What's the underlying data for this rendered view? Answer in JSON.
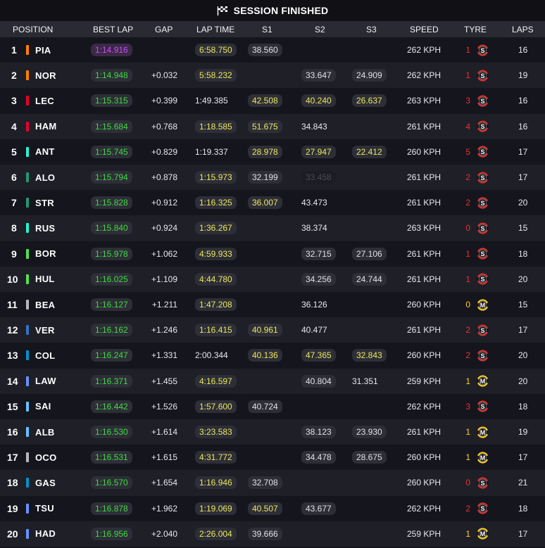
{
  "session": {
    "title": "SESSION FINISHED",
    "icon": "checkered-flag-icon"
  },
  "columns": {
    "position": "POSITION",
    "best_lap": "BEST LAP",
    "gap": "GAP",
    "lap_time": "LAP TIME",
    "s1": "S1",
    "s2": "S2",
    "s3": "S3",
    "speed": "SPEED",
    "tyre": "TYRE",
    "laps": "LAPS"
  },
  "colors": {
    "best_lap_overall": "#c94cff",
    "personal_best": "#3ddc3d",
    "yellow_time": "#e8e85a",
    "soft_tyre": "#e2342c",
    "medium_tyre": "#ffd21e",
    "mclaren": "#ff8000",
    "ferrari": "#e8002d",
    "mercedes": "#27f4d2",
    "aston_martin": "#229971",
    "sauber": "#52e252",
    "haas": "#b6babd",
    "red_bull": "#3671c6",
    "alpine": "#0093cc",
    "williams": "#64c4ff",
    "racing_bulls": "#6692ff"
  },
  "rows": [
    {
      "pos": "1",
      "driver": "PIA",
      "team_color": "#ff8000",
      "best_lap": "1:14.916",
      "best_lap_style": "purple",
      "gap": "",
      "lap_time": "6:58.750",
      "lap_time_style": "yellow",
      "s1": "38.560",
      "s1_style": "grey",
      "s2": "",
      "s2_style": "",
      "s3": "",
      "s3_style": "",
      "speed": "262 KPH",
      "tyre_age": "1",
      "tyre": "S",
      "laps": "16"
    },
    {
      "pos": "2",
      "driver": "NOR",
      "team_color": "#ff8000",
      "best_lap": "1:14.948",
      "best_lap_style": "green",
      "gap": "+0.032",
      "lap_time": "5:58.232",
      "lap_time_style": "yellow",
      "s1": "",
      "s1_style": "",
      "s2": "33.647",
      "s2_style": "grey",
      "s3": "24.909",
      "s3_style": "grey",
      "speed": "262 KPH",
      "tyre_age": "1",
      "tyre": "S",
      "laps": "19"
    },
    {
      "pos": "3",
      "driver": "LEC",
      "team_color": "#e8002d",
      "best_lap": "1:15.315",
      "best_lap_style": "green",
      "gap": "+0.399",
      "lap_time": "1:49.385",
      "lap_time_style": "plain",
      "s1": "42.508",
      "s1_style": "yellow",
      "s2": "40.240",
      "s2_style": "yellow",
      "s3": "26.637",
      "s3_style": "yellow",
      "speed": "263 KPH",
      "tyre_age": "3",
      "tyre": "S",
      "laps": "16"
    },
    {
      "pos": "4",
      "driver": "HAM",
      "team_color": "#e8002d",
      "best_lap": "1:15.684",
      "best_lap_style": "green",
      "gap": "+0.768",
      "lap_time": "1:18.585",
      "lap_time_style": "yellow",
      "s1": "51.675",
      "s1_style": "yellow",
      "s2": "34.843",
      "s2_style": "plain",
      "s3": "",
      "s3_style": "",
      "speed": "261 KPH",
      "tyre_age": "4",
      "tyre": "S",
      "laps": "16"
    },
    {
      "pos": "5",
      "driver": "ANT",
      "team_color": "#27f4d2",
      "best_lap": "1:15.745",
      "best_lap_style": "green",
      "gap": "+0.829",
      "lap_time": "1:19.337",
      "lap_time_style": "plain",
      "s1": "28.978",
      "s1_style": "yellow",
      "s2": "27.947",
      "s2_style": "yellow",
      "s3": "22.412",
      "s3_style": "yellow",
      "speed": "260 KPH",
      "tyre_age": "5",
      "tyre": "S",
      "laps": "17"
    },
    {
      "pos": "6",
      "driver": "ALO",
      "team_color": "#229971",
      "best_lap": "1:15.794",
      "best_lap_style": "green",
      "gap": "+0.878",
      "lap_time": "1:15.973",
      "lap_time_style": "yellow",
      "s1": "32.199",
      "s1_style": "grey",
      "s2": "33.458",
      "s2_style": "faint",
      "s3": "",
      "s3_style": "",
      "speed": "261 KPH",
      "tyre_age": "2",
      "tyre": "S",
      "laps": "17"
    },
    {
      "pos": "7",
      "driver": "STR",
      "team_color": "#229971",
      "best_lap": "1:15.828",
      "best_lap_style": "green",
      "gap": "+0.912",
      "lap_time": "1:16.325",
      "lap_time_style": "yellow",
      "s1": "36.007",
      "s1_style": "yellow",
      "s2": "43.473",
      "s2_style": "plain",
      "s3": "",
      "s3_style": "",
      "speed": "261 KPH",
      "tyre_age": "2",
      "tyre": "S",
      "laps": "20"
    },
    {
      "pos": "8",
      "driver": "RUS",
      "team_color": "#27f4d2",
      "best_lap": "1:15.840",
      "best_lap_style": "green",
      "gap": "+0.924",
      "lap_time": "1:36.267",
      "lap_time_style": "yellow",
      "s1": "",
      "s1_style": "",
      "s2": "38.374",
      "s2_style": "plain",
      "s3": "",
      "s3_style": "",
      "speed": "263 KPH",
      "tyre_age": "0",
      "tyre": "S",
      "laps": "15"
    },
    {
      "pos": "9",
      "driver": "BOR",
      "team_color": "#52e252",
      "best_lap": "1:15.978",
      "best_lap_style": "green",
      "gap": "+1.062",
      "lap_time": "4:59.933",
      "lap_time_style": "yellow",
      "s1": "",
      "s1_style": "",
      "s2": "32.715",
      "s2_style": "grey",
      "s3": "27.106",
      "s3_style": "grey",
      "speed": "261 KPH",
      "tyre_age": "1",
      "tyre": "S",
      "laps": "18"
    },
    {
      "pos": "10",
      "driver": "HUL",
      "team_color": "#52e252",
      "best_lap": "1:16.025",
      "best_lap_style": "green",
      "gap": "+1.109",
      "lap_time": "4:44.780",
      "lap_time_style": "yellow",
      "s1": "",
      "s1_style": "",
      "s2": "34.256",
      "s2_style": "grey",
      "s3": "24.744",
      "s3_style": "grey",
      "speed": "261 KPH",
      "tyre_age": "1",
      "tyre": "S",
      "laps": "20"
    },
    {
      "pos": "11",
      "driver": "BEA",
      "team_color": "#b6babd",
      "best_lap": "1:16.127",
      "best_lap_style": "green",
      "gap": "+1.211",
      "lap_time": "1:47.208",
      "lap_time_style": "yellow",
      "s1": "",
      "s1_style": "",
      "s2": "36.126",
      "s2_style": "plain",
      "s3": "",
      "s3_style": "",
      "speed": "260 KPH",
      "tyre_age": "0",
      "tyre": "M",
      "laps": "15"
    },
    {
      "pos": "12",
      "driver": "VER",
      "team_color": "#3671c6",
      "best_lap": "1:16.162",
      "best_lap_style": "green",
      "gap": "+1.246",
      "lap_time": "1:16.415",
      "lap_time_style": "yellow",
      "s1": "40.961",
      "s1_style": "yellow",
      "s2": "40.477",
      "s2_style": "plain",
      "s3": "",
      "s3_style": "",
      "speed": "261 KPH",
      "tyre_age": "2",
      "tyre": "S",
      "laps": "17"
    },
    {
      "pos": "13",
      "driver": "COL",
      "team_color": "#0093cc",
      "best_lap": "1:16.247",
      "best_lap_style": "green",
      "gap": "+1.331",
      "lap_time": "2:00.344",
      "lap_time_style": "plain",
      "s1": "40.136",
      "s1_style": "yellow",
      "s2": "47.365",
      "s2_style": "yellow",
      "s3": "32.843",
      "s3_style": "yellow",
      "speed": "260 KPH",
      "tyre_age": "2",
      "tyre": "S",
      "laps": "20"
    },
    {
      "pos": "14",
      "driver": "LAW",
      "team_color": "#6692ff",
      "best_lap": "1:16.371",
      "best_lap_style": "green",
      "gap": "+1.455",
      "lap_time": "4:16.597",
      "lap_time_style": "yellow",
      "s1": "",
      "s1_style": "",
      "s2": "40.804",
      "s2_style": "grey",
      "s3": "31.351",
      "s3_style": "plain",
      "speed": "259 KPH",
      "tyre_age": "1",
      "tyre": "M",
      "laps": "20"
    },
    {
      "pos": "15",
      "driver": "SAI",
      "team_color": "#64c4ff",
      "best_lap": "1:16.442",
      "best_lap_style": "green",
      "gap": "+1.526",
      "lap_time": "1:57.600",
      "lap_time_style": "yellow",
      "s1": "40.724",
      "s1_style": "grey",
      "s2": "",
      "s2_style": "",
      "s3": "",
      "s3_style": "",
      "speed": "262 KPH",
      "tyre_age": "3",
      "tyre": "S",
      "laps": "18"
    },
    {
      "pos": "16",
      "driver": "ALB",
      "team_color": "#64c4ff",
      "best_lap": "1:16.530",
      "best_lap_style": "green",
      "gap": "+1.614",
      "lap_time": "3:23.583",
      "lap_time_style": "yellow",
      "s1": "",
      "s1_style": "",
      "s2": "38.123",
      "s2_style": "grey",
      "s3": "23.930",
      "s3_style": "grey",
      "speed": "261 KPH",
      "tyre_age": "1",
      "tyre": "M",
      "laps": "19"
    },
    {
      "pos": "17",
      "driver": "OCO",
      "team_color": "#b6babd",
      "best_lap": "1:16.531",
      "best_lap_style": "green",
      "gap": "+1.615",
      "lap_time": "4:31.772",
      "lap_time_style": "yellow",
      "s1": "",
      "s1_style": "",
      "s2": "34.478",
      "s2_style": "grey",
      "s3": "28.675",
      "s3_style": "grey",
      "speed": "260 KPH",
      "tyre_age": "1",
      "tyre": "M",
      "laps": "17"
    },
    {
      "pos": "18",
      "driver": "GAS",
      "team_color": "#0093cc",
      "best_lap": "1:16.570",
      "best_lap_style": "green",
      "gap": "+1.654",
      "lap_time": "1:16.946",
      "lap_time_style": "yellow",
      "s1": "32.708",
      "s1_style": "grey",
      "s2": "",
      "s2_style": "",
      "s3": "",
      "s3_style": "",
      "speed": "260 KPH",
      "tyre_age": "0",
      "tyre": "S",
      "laps": "21"
    },
    {
      "pos": "19",
      "driver": "TSU",
      "team_color": "#6692ff",
      "best_lap": "1:16.878",
      "best_lap_style": "green",
      "gap": "+1.962",
      "lap_time": "1:19.069",
      "lap_time_style": "yellow",
      "s1": "40.507",
      "s1_style": "yellow",
      "s2": "43.677",
      "s2_style": "grey",
      "s3": "",
      "s3_style": "",
      "speed": "262 KPH",
      "tyre_age": "2",
      "tyre": "S",
      "laps": "18"
    },
    {
      "pos": "20",
      "driver": "HAD",
      "team_color": "#6692ff",
      "best_lap": "1:16.956",
      "best_lap_style": "green",
      "gap": "+2.040",
      "lap_time": "2:26.004",
      "lap_time_style": "yellow",
      "s1": "39.666",
      "s1_style": "grey",
      "s2": "",
      "s2_style": "",
      "s3": "",
      "s3_style": "",
      "speed": "259 KPH",
      "tyre_age": "1",
      "tyre": "M",
      "laps": "17"
    }
  ]
}
